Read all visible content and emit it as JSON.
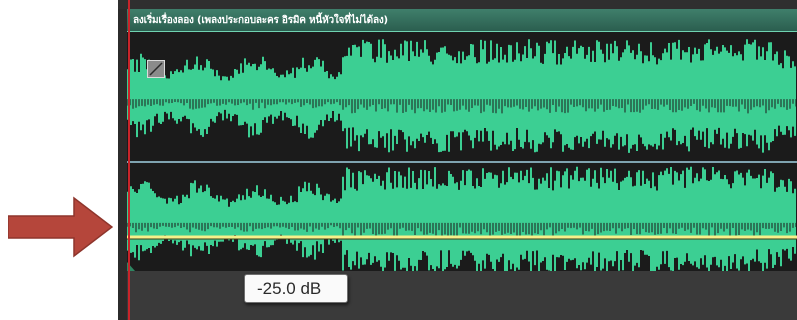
{
  "clip": {
    "title": "ลงเริ่มเรื่องลอง (เพลงประกอบละคร อิรมิค หนี้หัวใจที่ไม่ได้ลง)",
    "waveform_color": "#3ccf93",
    "header_color": "#3f7f6b"
  },
  "volume_envelope": {
    "tooltip": "-25.0 dB",
    "line_color": "#f5f08a"
  },
  "playhead_color": "#c8242a",
  "annotation_arrow_color": "#b5463b"
}
